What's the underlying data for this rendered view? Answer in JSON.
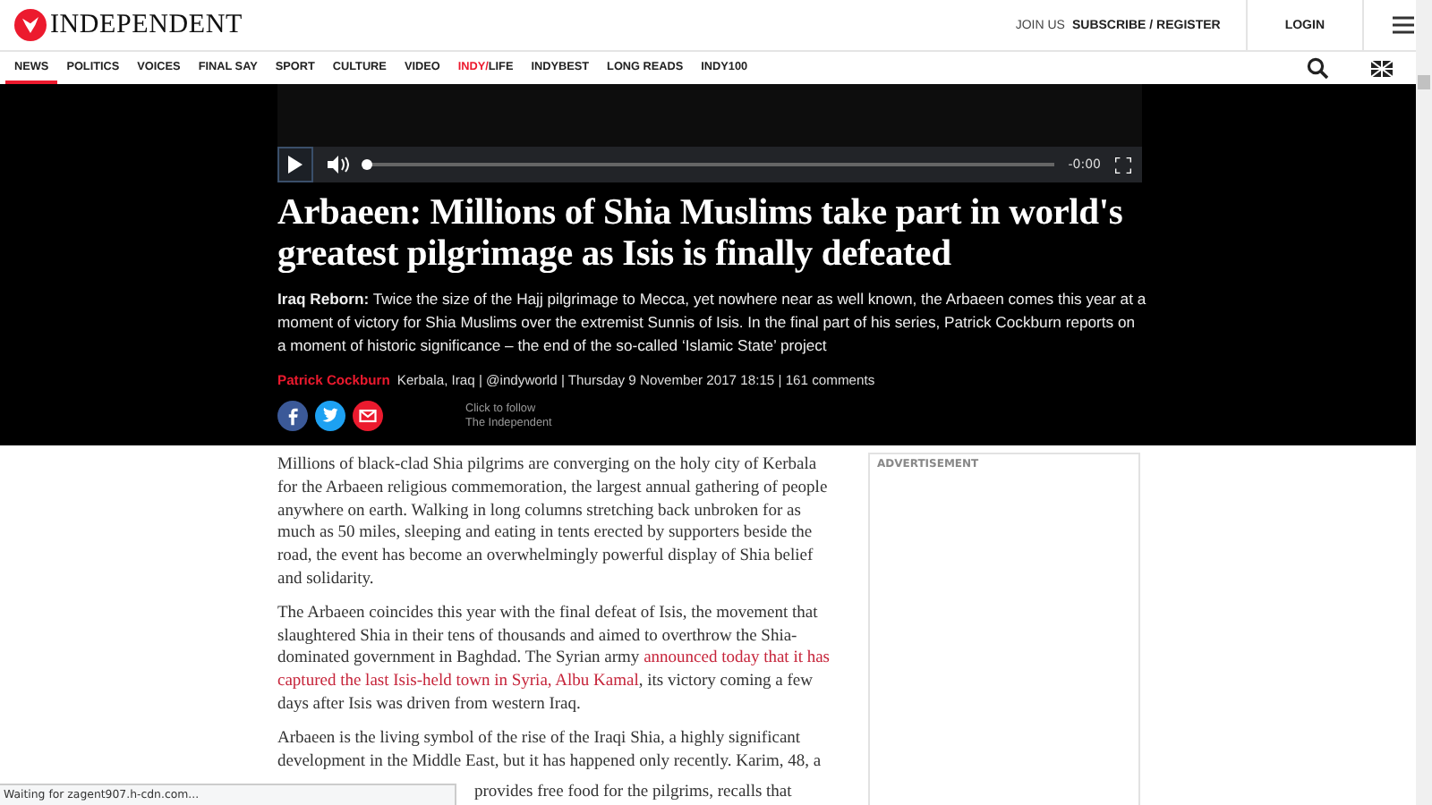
{
  "header": {
    "logo": "INDEPENDENT",
    "join": "JOIN US",
    "subscribe": "SUBSCRIBE / REGISTER",
    "login": "LOGIN"
  },
  "nav": [
    {
      "label": "NEWS",
      "selected": true
    },
    {
      "label": "POLITICS",
      "selected": false
    },
    {
      "label": "VOICES",
      "selected": false
    },
    {
      "label": "FINAL SAY",
      "selected": false
    },
    {
      "label": "SPORT",
      "selected": false
    },
    {
      "label": "CULTURE",
      "selected": false
    },
    {
      "label": "VIDEO",
      "selected": false
    },
    {
      "label": "INDY/",
      "label_suffix": "LIFE",
      "selected": false
    },
    {
      "label": "INDYBEST",
      "selected": false
    },
    {
      "label": "LONG READS",
      "selected": false
    },
    {
      "label": "INDY100",
      "selected": false
    }
  ],
  "video": {
    "time": "-0:00",
    "level": 0
  },
  "article": {
    "title": "Arbaeen: Millions of Shia Muslims take part in world's greatest pilgrimage as Isis is finally defeated",
    "standfirst": "**Iraq Reborn:** Twice the size of the Hajj pilgrimage to Mecca, yet nowhere near as well known, the Arbaeen comes this year at a moment of victory for Shia Muslims over the extremist Sunnis of Isis. In the final part of his series, Patrick Cockburn reports on a moment of historic significance – the end of the so-called ‘Islamic State’ project",
    "author": "Patrick Cockburn",
    "meta": "Kerbala, Iraq | @indyworld | Thursday 9 November 2017 18:15  | 161 comments",
    "follow": [
      "Click to follow",
      "The Independent"
    ],
    "paragraphs": [
      {
        "lines": [
          [
            {
              "text": "Millions of black-clad Shia pilgrims are converging on the holy city of Kerbala",
              "link": false
            }
          ],
          [
            {
              "text": "for the Arbaeen religious commemoration, the largest annual gathering of people",
              "link": false
            }
          ],
          [
            {
              "text": "anywhere on earth. Walking in long columns stretching back unbroken for as",
              "link": false
            }
          ],
          [
            {
              "text": "much as 50 miles, sleeping and eating in tents erected by supporters beside the",
              "link": false
            }
          ],
          [
            {
              "text": "road, the event has become an overwhelmingly powerful display of Shia belief",
              "link": false
            }
          ],
          [
            {
              "text": "and solidarity.",
              "link": false
            }
          ]
        ]
      },
      {
        "lines": [
          [
            {
              "text": "The Arbaeen coincides this year with the final defeat of Isis, the movement that",
              "link": false
            }
          ],
          [
            {
              "text": "slaughtered Shia in their tens of thousands and aimed to overthrow the Shia-",
              "link": false
            }
          ],
          [
            {
              "text": "dominated government in Baghdad. The Syrian army ",
              "link": false
            },
            {
              "text": "announced today that it has",
              "link": true
            }
          ],
          [
            {
              "text": "captured the last Isis-held town in Syria, Albu Kamal",
              "link": true
            },
            {
              "text": ", its victory coming a few",
              "link": false
            }
          ],
          [
            {
              "text": "days after Isis was driven from western Iraq.",
              "link": false
            }
          ]
        ]
      },
      {
        "lines": [
          [
            {
              "text": "Arbaeen is the living symbol of the rise of the Iraqi Shia, a highly significant",
              "link": false
            }
          ],
          [
            {
              "text": "development in the Middle East, but it has happened only recently. Karim, 48, a",
              "link": false
            }
          ]
        ]
      }
    ],
    "partial_line": "provides free food for the pilgrims, recalls that"
  },
  "ad": {
    "label": "ADVERTISEMENT"
  },
  "status_bar": "Waiting for zagent907.h-cdn.com..."
}
